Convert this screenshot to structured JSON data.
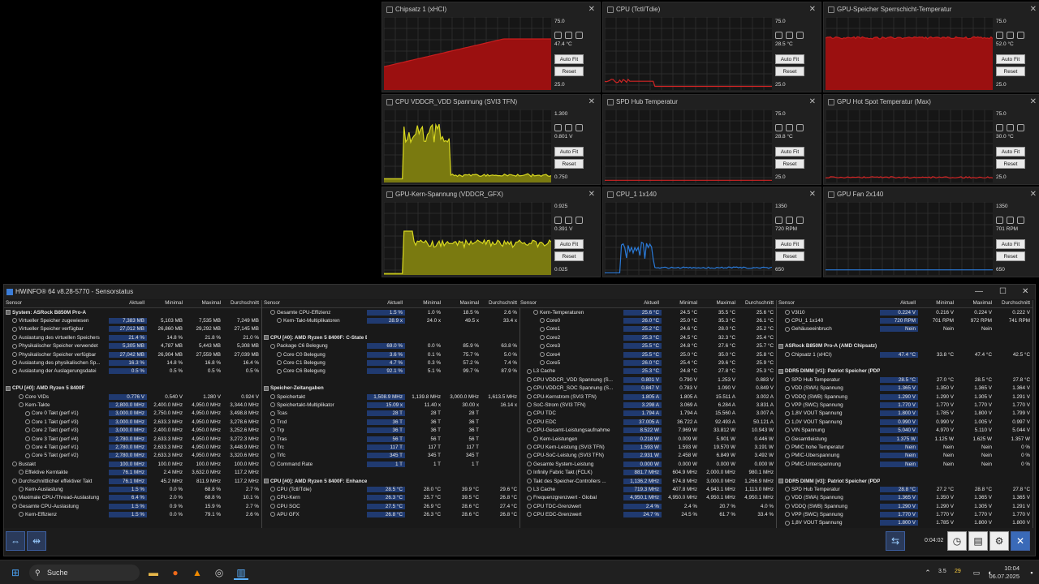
{
  "graphs": [
    {
      "title": "Chipsatz 1 (xHCI)",
      "max": "75.0",
      "cur": "47.4 °C",
      "min": "25.0",
      "color": "#c81e1e",
      "fill": "#9b1010",
      "autofit": "Auto Fit",
      "reset": "Reset"
    },
    {
      "title": "CPU (Tctl/Tdie)",
      "max": "75.0",
      "cur": "28.5 °C",
      "min": "25.0",
      "color": "#d02424",
      "fill": "",
      "autofit": "Auto Fit",
      "reset": "Reset"
    },
    {
      "title": "GPU-Speicher Sperrschicht-Temperatur",
      "max": "75.0",
      "cur": "52.0 °C",
      "min": "25.0",
      "color": "#c81e1e",
      "fill": "#9b1010",
      "autofit": "Auto Fit",
      "reset": "Reset"
    },
    {
      "title": "CPU VDDCR_VDD Spannung (SVI3 TFN)",
      "max": "1.300",
      "cur": "0.801 V",
      "min": "0.750",
      "color": "#d8d820",
      "fill": "#7a7a10",
      "autofit": "Auto Fit",
      "reset": "Reset"
    },
    {
      "title": "SPD Hub Temperatur",
      "max": "75.0",
      "cur": "28.8 °C",
      "min": "25.0",
      "color": "#d02424",
      "fill": "",
      "autofit": "Auto Fit",
      "reset": "Reset"
    },
    {
      "title": "GPU Hot Spot Temperatur (Max)",
      "max": "75.0",
      "cur": "30.0 °C",
      "min": "25.0",
      "color": "#d02424",
      "fill": "",
      "autofit": "Auto Fit",
      "reset": "Reset"
    },
    {
      "title": "GPU-Kern-Spannung (VDDCR_GFX)",
      "max": "0.925",
      "cur": "0.391 V",
      "min": "0.025",
      "color": "#d8d820",
      "fill": "#7a7a10",
      "autofit": "Auto Fit",
      "reset": "Reset"
    },
    {
      "title": "CPU_1 1x140",
      "max": "1350",
      "cur": "720 RPM",
      "min": "650",
      "color": "#2a7ad8",
      "fill": "",
      "autofit": "Auto Fit",
      "reset": "Reset"
    },
    {
      "title": "GPU Fan 2x140",
      "max": "1350",
      "cur": "701 RPM",
      "min": "650",
      "color": "#2a7ad8",
      "fill": "",
      "autofit": "Auto Fit",
      "reset": "Reset"
    }
  ],
  "hwinfo": {
    "title": "HWiNFO® 64 v8.28-5770 - Sensorstatus",
    "clock": "0:04:02"
  },
  "headers": [
    "Sensor",
    "Aktuell",
    "Minimal",
    "Maximal",
    "Durchschnitt"
  ],
  "panes": [
    [
      [
        "g",
        "System: ASRock B850M Pro-A",
        "",
        "",
        "",
        ""
      ],
      [
        "1",
        "Virtueller Speicher zugewiesen",
        "7,383 MB",
        "5,103 MB",
        "7,535 MB",
        "7,249 MB"
      ],
      [
        "1",
        "Virtueller Speicher verfügbar",
        "27,012 MB",
        "26,860 MB",
        "29,292 MB",
        "27,145 MB"
      ],
      [
        "1",
        "Auslastung des virtuellen Speichers",
        "21.4 %",
        "14.8 %",
        "21.8 %",
        "21.0 %"
      ],
      [
        "1",
        "Physikalischer Speicher verwendet",
        "5,305 MB",
        "4,787 MB",
        "5,443 MB",
        "5,308 MB"
      ],
      [
        "1",
        "Physikalischer Speicher verfügbar",
        "27,042 MB",
        "26,904 MB",
        "27,559 MB",
        "27,039 MB"
      ],
      [
        "1",
        "Auslastung des physikalischen Sp...",
        "16.3 %",
        "14.8 %",
        "16.8 %",
        "16.4 %"
      ],
      [
        "1",
        "Auslastung der Auslagerungsdatei",
        "0.5 %",
        "0.5 %",
        "0.5 %",
        "0.5 %"
      ],
      [
        "e",
        "",
        "",
        "",
        "",
        ""
      ],
      [
        "g",
        "CPU [#0]: AMD Ryzen 5 8400F",
        "",
        "",
        "",
        ""
      ],
      [
        "2",
        "Core VIDs",
        "0.776 V",
        "0.540 V",
        "1.280 V",
        "0.924 V"
      ],
      [
        "2",
        "Kern-Takte",
        "2,800.0 MHz",
        "2,400.0 MHz",
        "4,950.0 MHz",
        "3,344.0 MHz"
      ],
      [
        "3",
        "Core 0 Takt (perf #1)",
        "3,000.0 MHz",
        "2,750.0 MHz",
        "4,950.0 MHz",
        "3,498.8 MHz"
      ],
      [
        "3",
        "Core 1 Takt (perf #3)",
        "3,000.0 MHz",
        "2,633.3 MHz",
        "4,950.0 MHz",
        "3,278.6 MHz"
      ],
      [
        "3",
        "Core 2 Takt (perf #3)",
        "3,000.0 MHz",
        "2,400.0 MHz",
        "4,950.0 MHz",
        "3,252.6 MHz"
      ],
      [
        "3",
        "Core 3 Takt (perf #4)",
        "2,780.0 MHz",
        "2,633.3 MHz",
        "4,950.0 MHz",
        "3,272.3 MHz"
      ],
      [
        "3",
        "Core 4 Takt (perf #1)",
        "2,780.0 MHz",
        "2,633.3 MHz",
        "4,950.0 MHz",
        "3,448.9 MHz"
      ],
      [
        "3",
        "Core 5 Takt (perf #2)",
        "2,780.0 MHz",
        "2,633.3 MHz",
        "4,950.0 MHz",
        "3,320.6 MHz"
      ],
      [
        "1",
        "Bustakt",
        "100.0 MHz",
        "100.0 MHz",
        "100.0 MHz",
        "100.0 MHz"
      ],
      [
        "2",
        "Effektive Kerntakte",
        "76.1 MHz",
        "2.4 MHz",
        "3,632.0 MHz",
        "117.2 MHz"
      ],
      [
        "1",
        "Durchschnittlicher effektiver Takt",
        "76.1 MHz",
        "45.2 MHz",
        "811.9 MHz",
        "117.2 MHz"
      ],
      [
        "2",
        "Kern-Auslastung",
        "1.5 %",
        "0.0 %",
        "68.8 %",
        "2.7 %"
      ],
      [
        "1",
        "Maximale CPU-/Thread-Auslastung",
        "6.4 %",
        "2.0 %",
        "68.8 %",
        "10.1 %"
      ],
      [
        "1",
        "Gesamte CPU-Auslastung",
        "1.5 %",
        "0.9 %",
        "15.9 %",
        "2.7 %"
      ],
      [
        "2",
        "Kern-Effizienz",
        "1.5 %",
        "0.0 %",
        "79.1 %",
        "2.6 %"
      ]
    ],
    [
      [
        "1",
        "Gesamte CPU-Effizienz",
        "1.5 %",
        "1.0 %",
        "18.5 %",
        "2.6 %"
      ],
      [
        "2",
        "Kern-Takt-Multiplikatoren",
        "28.9 x",
        "24.0 x",
        "49.5 x",
        "33.4 x"
      ],
      [
        "e",
        "",
        "",
        "",
        "",
        ""
      ],
      [
        "g",
        "CPU [#0]: AMD Ryzen 5 8400F: C-State Belegung",
        "",
        "",
        "",
        ""
      ],
      [
        "1",
        "Package C6 Belegung",
        "69.0 %",
        "0.0 %",
        "85.9 %",
        "63.8 %"
      ],
      [
        "2",
        "Core C0 Belegung",
        "3.6 %",
        "0.1 %",
        "75.7 %",
        "5.0 %"
      ],
      [
        "2",
        "Core C1 Belegung",
        "4.7 %",
        "0.3 %",
        "57.2 %",
        "7.4 %"
      ],
      [
        "2",
        "Core C6 Belegung",
        "92.1 %",
        "5.1 %",
        "99.7 %",
        "87.9 %"
      ],
      [
        "e",
        "",
        "",
        "",
        "",
        ""
      ],
      [
        "g",
        "Speicher-Zeitangaben",
        "",
        "",
        "",
        ""
      ],
      [
        "1",
        "Speichertakt",
        "1,508.9 MHz",
        "1,139.8 MHz",
        "3,000.0 MHz",
        "1,613.5 MHz"
      ],
      [
        "1",
        "Speichertakt-Multiplikator",
        "15.09 x",
        "11.40 x",
        "30.00 x",
        "16.14 x"
      ],
      [
        "1",
        "Tcas",
        "28 T",
        "28 T",
        "28 T",
        ""
      ],
      [
        "1",
        "Trcd",
        "36 T",
        "36 T",
        "36 T",
        ""
      ],
      [
        "1",
        "Trp",
        "36 T",
        "36 T",
        "36 T",
        ""
      ],
      [
        "1",
        "Tras",
        "56 T",
        "56 T",
        "56 T",
        ""
      ],
      [
        "1",
        "Trc",
        "117 T",
        "117 T",
        "117 T",
        ""
      ],
      [
        "1",
        "Trfc",
        "345 T",
        "345 T",
        "345 T",
        ""
      ],
      [
        "1",
        "Command Rate",
        "1 T",
        "1 T",
        "1 T",
        ""
      ],
      [
        "e",
        "",
        "",
        "",
        "",
        ""
      ],
      [
        "g",
        "CPU [#0]: AMD Ryzen 5 8400F: Enhanced",
        "",
        "",
        "",
        ""
      ],
      [
        "1",
        "CPU (Tctl/Tdie)",
        "28.5 °C",
        "28.0 °C",
        "39.9 °C",
        "29.6 °C"
      ],
      [
        "1",
        "CPU-Kern",
        "26.3 °C",
        "25.7 °C",
        "39.5 °C",
        "26.8 °C"
      ],
      [
        "1",
        "CPU SOC",
        "27.5 °C",
        "26.9 °C",
        "28.6 °C",
        "27.4 °C"
      ],
      [
        "1",
        "APU GFX",
        "26.8 °C",
        "26.3 °C",
        "28.6 °C",
        "26.8 °C"
      ]
    ],
    [
      [
        "2",
        "Kern-Temperaturen",
        "25.6 °C",
        "24.5 °C",
        "35.5 °C",
        "25.6 °C"
      ],
      [
        "3",
        "Core0",
        "26.0 °C",
        "25.0 °C",
        "35.3 °C",
        "26.1 °C"
      ],
      [
        "3",
        "Core1",
        "25.2 °C",
        "24.6 °C",
        "28.0 °C",
        "25.2 °C"
      ],
      [
        "3",
        "Core2",
        "25.3 °C",
        "24.5 °C",
        "32.3 °C",
        "25.4 °C"
      ],
      [
        "3",
        "Core3",
        "25.5 °C",
        "24.8 °C",
        "27.6 °C",
        "25.7 °C"
      ],
      [
        "3",
        "Core4",
        "25.5 °C",
        "25.0 °C",
        "35.0 °C",
        "25.8 °C"
      ],
      [
        "3",
        "Core5",
        "26.0 °C",
        "25.4 °C",
        "29.6 °C",
        "25.9 °C"
      ],
      [
        "1",
        "L3 Cache",
        "25.3 °C",
        "24.8 °C",
        "27.8 °C",
        "25.3 °C"
      ],
      [
        "1",
        "CPU VDDCR_VDD Spannung (S...",
        "0.801 V",
        "0.790 V",
        "1.253 V",
        "0.883 V"
      ],
      [
        "1",
        "CPU VDDCR_SOC Spannung (S...",
        "0.847 V",
        "0.783 V",
        "1.090 V",
        "0.849 V"
      ],
      [
        "1",
        "CPU-Kernstrom (SVI3 TFN)",
        "1.805 A",
        "1.805 A",
        "15.511 A",
        "3.002 A"
      ],
      [
        "1",
        "SoC-Strom (SVI3 TFN)",
        "3.298 A",
        "3.069 A",
        "6.284 A",
        "3.831 A"
      ],
      [
        "1",
        "CPU TDC",
        "1.794 A",
        "1.794 A",
        "15.560 A",
        "3.007 A"
      ],
      [
        "1",
        "CPU EDC",
        "37.005 A",
        "36.722 A",
        "92.493 A",
        "50.121 A"
      ],
      [
        "1",
        "CPU-Gesamt-Leistungsaufnahme",
        "8.522 W",
        "7.969 W",
        "33.812 W",
        "10.943 W"
      ],
      [
        "2",
        "Kern-Leistungen",
        "0.218 W",
        "0.009 W",
        "5.901 W",
        "0.446 W"
      ],
      [
        "1",
        "CPU Kern-Leistung (SVI3 TFN)",
        "1.593 W",
        "1.593 W",
        "19.570 W",
        "3.191 W"
      ],
      [
        "1",
        "CPU-SoC-Leistung (SVI3 TFN)",
        "2.931 W",
        "2.458 W",
        "6.849 W",
        "3.492 W"
      ],
      [
        "1",
        "Gesamte System-Leistung",
        "0.000 W",
        "0.000 W",
        "0.000 W",
        "0.000 W"
      ],
      [
        "1",
        "Infinity Fabric Takt (FCLK)",
        "881.7 MHz",
        "604.9 MHz",
        "2,000.0 MHz",
        "980.1 MHz"
      ],
      [
        "1",
        "Takt des Speicher-Controllers ...",
        "1,136.2 MHz",
        "674.8 MHz",
        "3,000.0 MHz",
        "1,266.9 MHz"
      ],
      [
        "1",
        "L3 Cache",
        "719.3 MHz",
        "407.8 MHz",
        "4,943.1 MHz",
        "1,113.0 MHz"
      ],
      [
        "1",
        "Frequenzgrenzwert - Global",
        "4,950.1 MHz",
        "4,950.0 MHz",
        "4,950.1 MHz",
        "4,950.1 MHz"
      ],
      [
        "1",
        "CPU TDC-Grenzwert",
        "2.4 %",
        "2.4 %",
        "20.7 %",
        "4.0 %"
      ],
      [
        "1",
        "CPU EDC-Grenzwert",
        "24.7 %",
        "24.5 %",
        "61.7 %",
        "33.4 %"
      ]
    ],
    [
      [
        "1",
        "V3I10",
        "0.224 V",
        "0.216 V",
        "0.224 V",
        "0.222 V"
      ],
      [
        "1",
        "CPU_1 1x140",
        "720 RPM",
        "701 RPM",
        "972 RPM",
        "741 RPM"
      ],
      [
        "1",
        "Gehäuseeinbruch",
        "Nein",
        "Nein",
        "Nein",
        ""
      ],
      [
        "e",
        "",
        "",
        "",
        "",
        ""
      ],
      [
        "g",
        "ASRock B850M Pro-A (AMD Chipsatz)",
        "",
        "",
        "",
        ""
      ],
      [
        "1",
        "Chipsatz 1 (xHCI)",
        "47.4 °C",
        "33.8 °C",
        "47.4 °C",
        "42.5 °C"
      ],
      [
        "e",
        "",
        "",
        "",
        "",
        ""
      ],
      [
        "g",
        "DDR5 DIMM [#1]: Patriot Speicher (PDP Systems) 6000 Series (P0 CHANNEL A/DIMM...",
        "",
        "",
        "",
        ""
      ],
      [
        "1",
        "SPD Hub Temperatur",
        "28.5 °C",
        "27.0 °C",
        "28.5 °C",
        "27.8 °C"
      ],
      [
        "1",
        "VDD (SWA) Spannung",
        "1.365 V",
        "1.350 V",
        "1.365 V",
        "1.364 V"
      ],
      [
        "1",
        "VDDQ (SWB) Spannung",
        "1.290 V",
        "1.290 V",
        "1.305 V",
        "1.291 V"
      ],
      [
        "1",
        "VPP (SWC) Spannung",
        "1.770 V",
        "1.770 V",
        "1.770 V",
        "1.770 V"
      ],
      [
        "1",
        "1,8V VOUT Spannung",
        "1.800 V",
        "1.785 V",
        "1.800 V",
        "1.799 V"
      ],
      [
        "1",
        "1,0V VOUT Spannung",
        "0.990 V",
        "0.990 V",
        "1.005 V",
        "0.997 V"
      ],
      [
        "1",
        "VIN Spannung",
        "5.040 V",
        "4.970 V",
        "5.110 V",
        "5.044 V"
      ],
      [
        "1",
        "Gesamtleistung",
        "1.375 W",
        "1.125 W",
        "1.625 W",
        "1.357 W"
      ],
      [
        "1",
        "PMIC hohe Temperatur",
        "Nein",
        "Nein",
        "Nein",
        "0 %"
      ],
      [
        "1",
        "PMIC-Überspannung",
        "Nein",
        "Nein",
        "Nein",
        "0 %"
      ],
      [
        "1",
        "PMIC-Unterspannung",
        "Nein",
        "Nein",
        "Nein",
        "0 %"
      ],
      [
        "e",
        "",
        "",
        "",
        "",
        ""
      ],
      [
        "g",
        "DDR5 DIMM [#3]: Patriot Speicher (PDP Systems) 6000 Series (P0 CHANNEL B/DIMM...",
        "",
        "",
        "",
        ""
      ],
      [
        "1",
        "SPD Hub Temperatur",
        "28.8 °C",
        "27.2 °C",
        "28.8 °C",
        "27.8 °C"
      ],
      [
        "1",
        "VDD (SWA) Spannung",
        "1.365 V",
        "1.350 V",
        "1.365 V",
        "1.365 V"
      ],
      [
        "1",
        "VDDQ (SWB) Spannung",
        "1.290 V",
        "1.290 V",
        "1.305 V",
        "1.291 V"
      ],
      [
        "1",
        "VPP (SWC) Spannung",
        "1.770 V",
        "1.770 V",
        "1.770 V",
        "1.770 V"
      ],
      [
        "1",
        "1,8V VOUT Spannung",
        "1.800 V",
        "1.785 V",
        "1.800 V",
        "1.800 V"
      ]
    ]
  ],
  "taskbar": {
    "search": "Suche",
    "temp": "3.5",
    "wx": "29",
    "time": "10:04",
    "date": "06.07.2025"
  }
}
